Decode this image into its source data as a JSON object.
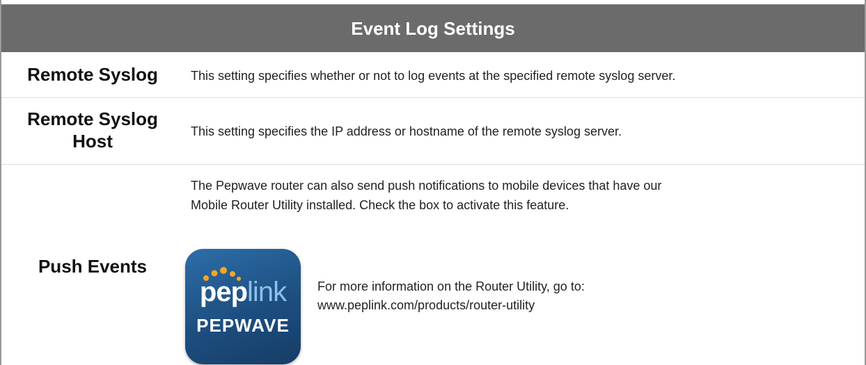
{
  "header": {
    "title": "Event Log Settings"
  },
  "rows": [
    {
      "label": "Remote Syslog",
      "description": "This setting specifies whether or not to log events at the specified remote syslog server."
    },
    {
      "label_line1": "Remote Syslog",
      "label_line2": "Host",
      "description": "This setting specifies the IP address or hostname of the remote syslog server."
    },
    {
      "label": "Push Events",
      "description_line1": "The Pepwave router can also send push notifications to mobile devices that have our",
      "description_line2": "Mobile Router Utility installed. Check the box to activate this feature.",
      "logo": {
        "brand_text_pep": "pep",
        "brand_text_link": "link",
        "product_text": "PEPWAVE"
      },
      "info_line1": "For more information on the Router Utility, go to:",
      "info_line2": "www.peplink.com/products/router-utility"
    }
  ],
  "colors": {
    "header_bg": "#6b6b6b",
    "header_text": "#ffffff",
    "row_divider": "#d7dfe8",
    "logo_bg": "#1d4e80",
    "logo_dots": "#f5a623"
  }
}
